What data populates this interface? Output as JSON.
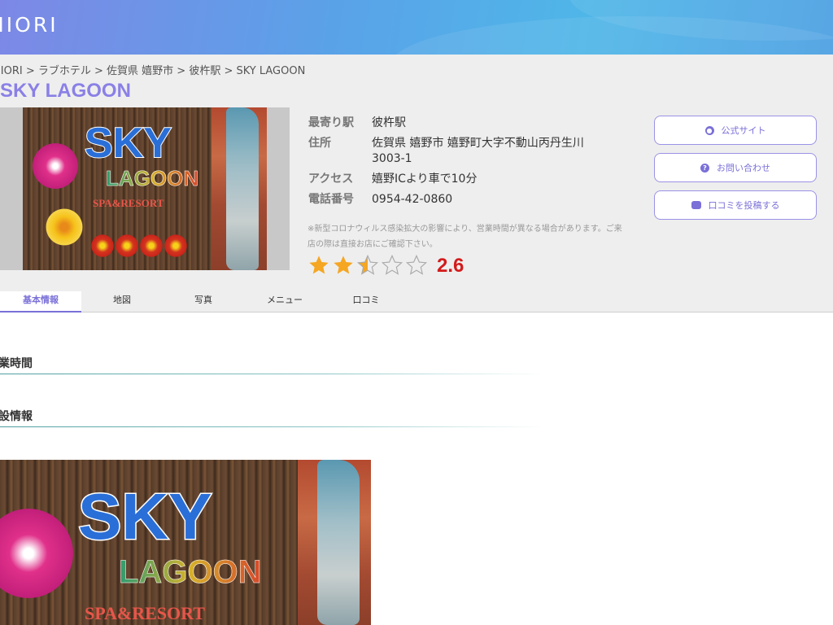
{
  "header": {
    "logo_text": "HIORI"
  },
  "breadcrumb": "HIORI > ラブホテル > 佐賀県 嬉野市 > 彼杵駅 > SKY LAGOON",
  "hotel": {
    "name": "SKY LAGOON",
    "sign": {
      "sky": "SKY",
      "lagoon": "LAGOON",
      "spa": "SPA&RESORT"
    }
  },
  "info": [
    {
      "label": "最寄り駅",
      "value": "彼杵駅"
    },
    {
      "label": "住所",
      "value": "佐賀県 嬉野市 嬉野町大字不動山丙丹生川3003-1"
    },
    {
      "label": "アクセス",
      "value": "嬉野ICより車で10分"
    },
    {
      "label": "電話番号",
      "value": "0954-42-0860"
    }
  ],
  "notice": "※新型コロナウィルス感染拡大の影響により、営業時間が異なる場合があります。ご来店の際は直接お店にご確認下さい。",
  "rating": {
    "value": "2.6",
    "stars_filled": 2.5,
    "stars_total": 5,
    "star_color": "#f5a623",
    "score_color": "#d31b1b"
  },
  "buttons": [
    {
      "label": "公式サイト",
      "icon": "globe-icon"
    },
    {
      "label": "お問い合わせ",
      "icon": "question-icon"
    },
    {
      "label": "口コミを投稿する",
      "icon": "comments-icon"
    }
  ],
  "tabs": [
    "基本情報",
    "地図",
    "写真",
    "メニュー",
    "口コミ"
  ],
  "active_tab": "基本情報",
  "sections": [
    {
      "title": "営業時間"
    },
    {
      "title": "施設情報"
    }
  ],
  "colors": {
    "accent": "#8a80e6",
    "header_start": "#7d88e6",
    "header_end": "#4a9fe2"
  }
}
